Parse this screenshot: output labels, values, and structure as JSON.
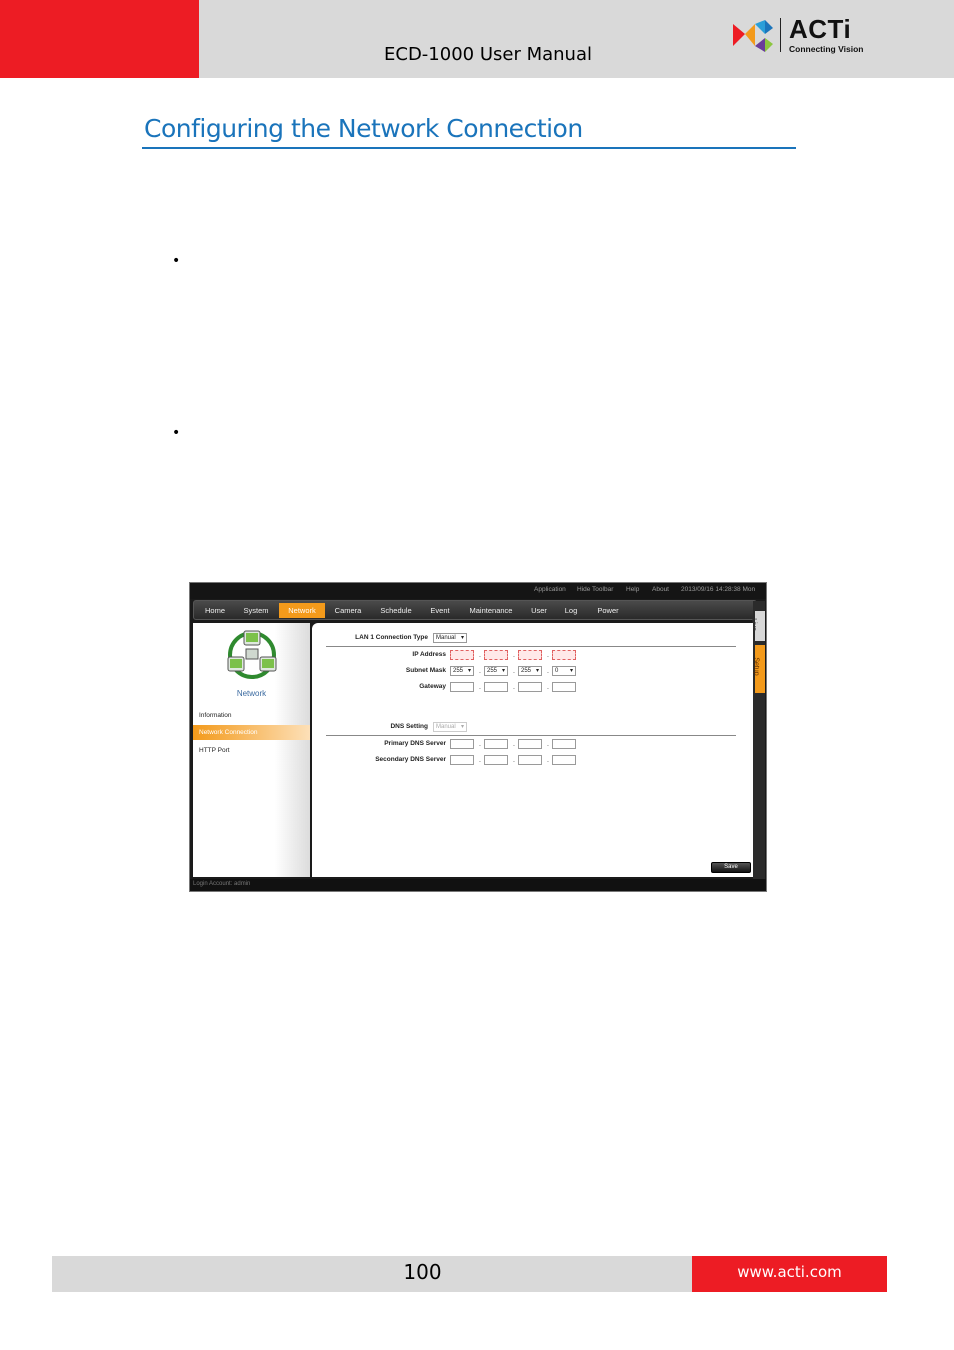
{
  "header": {
    "manual_title": "ECD-1000 User Manual",
    "logo_text": "ACTi",
    "logo_tagline": "Connecting Vision",
    "accent_red": "#ed1c24",
    "bar_gray": "#d9d9d9"
  },
  "section": {
    "heading": "Configuring the Network Connection",
    "heading_color": "#1a74bb",
    "bullets": [
      "•",
      "•"
    ]
  },
  "screenshot": {
    "topbar": {
      "application": "Application",
      "hide_toolbar": "Hide Toolbar",
      "help": "Help",
      "about": "About",
      "datetime": "2013/09/16 14:28:38 Mon"
    },
    "nav": [
      "Home",
      "System",
      "Network",
      "Camera",
      "Schedule",
      "Event",
      "Maintenance",
      "User",
      "Log",
      "Power"
    ],
    "nav_active": "Network",
    "side_tabs": {
      "live": "Live",
      "setup": "Setup"
    },
    "left_panel": {
      "title": "Network",
      "menu": [
        "Information",
        "Network Connection",
        "HTTP Port"
      ],
      "active": "Network Connection"
    },
    "form": {
      "lan_type_label": "LAN 1 Connection Type",
      "lan_type_value": "Manual",
      "ip_label": "IP Address",
      "subnet_label": "Subnet Mask",
      "subnet_values": [
        "255",
        "255",
        "255",
        "0"
      ],
      "gateway_label": "Gateway",
      "dns_setting_label": "DNS Setting",
      "dns_setting_value": "Manual",
      "primary_dns_label": "Primary DNS Server",
      "secondary_dns_label": "Secondary DNS Server",
      "separator": ".",
      "save_label": "Save"
    },
    "status": "Login Account: admin",
    "active_color": "#f39a1b"
  },
  "footer": {
    "page_number": "100",
    "url": "www.acti.com"
  }
}
